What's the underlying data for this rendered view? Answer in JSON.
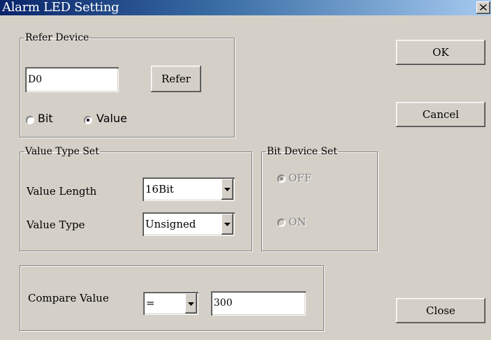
{
  "window": {
    "title": "Alarm LED Setting",
    "close_label": "X"
  },
  "refer_device": {
    "legend": "Refer Device",
    "device_value": "D0",
    "refer_button": "Refer",
    "options": [
      {
        "label": "Bit",
        "checked": false
      },
      {
        "label": "Value",
        "checked": true
      }
    ]
  },
  "value_type_set": {
    "legend": "Value Type Set",
    "length_label": "Value Length",
    "length_value": "16Bit",
    "type_label": "Value Type",
    "type_value": "Unsigned"
  },
  "bit_device_set": {
    "legend": "Bit Device Set",
    "options": [
      {
        "label": "OFF",
        "checked": true,
        "disabled": true
      },
      {
        "label": "ON",
        "checked": false,
        "disabled": true
      }
    ]
  },
  "compare": {
    "label": "Compare Value",
    "operator": "=",
    "value": "300"
  },
  "buttons": {
    "ok": "OK",
    "cancel": "Cancel",
    "close": "Close"
  },
  "colors": {
    "face": "#d4d0c8",
    "title_start": "#0a246a",
    "title_end": "#a6caf0"
  }
}
